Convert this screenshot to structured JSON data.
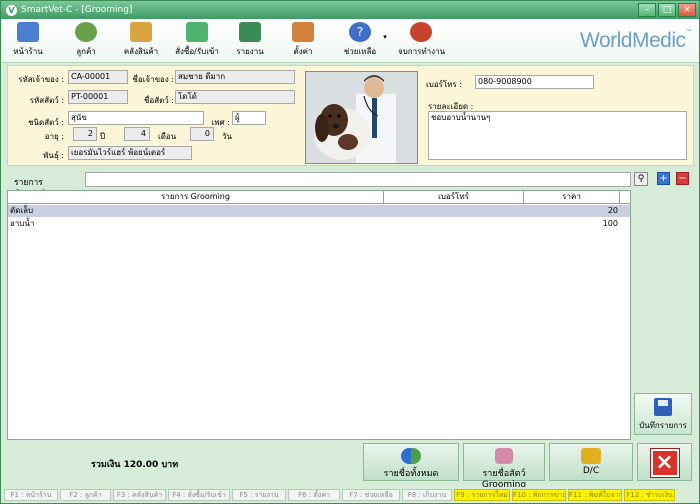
{
  "window": {
    "title": "SmartVet-C  - [Grooming]"
  },
  "toolbar": {
    "items": [
      {
        "label": "หน้าร้าน",
        "icon": "monitor-icon",
        "color": "#4a7fd0"
      },
      {
        "label": "ลูกค้า",
        "icon": "customers-icon",
        "color": "#6aa04a"
      },
      {
        "label": "คลังสินค้า",
        "icon": "warehouse-icon",
        "color": "#d9a441"
      },
      {
        "label": "สั่งซื้อ/รับเข้า",
        "icon": "order-icon",
        "color": "#4fb36f"
      },
      {
        "label": "รายงาน",
        "icon": "report-icon",
        "color": "#3c8a55"
      },
      {
        "label": "ตั้งค่า",
        "icon": "settings-icon",
        "color": "#d0813a"
      },
      {
        "label": "ช่วยเหลือ",
        "icon": "help-icon",
        "color": "#3f6fc8"
      },
      {
        "label": "จบการทำงาน",
        "icon": "exit-icon",
        "color": "#c8432e"
      }
    ],
    "logo": "WorldMedic"
  },
  "owner": {
    "owner_id_label": "รหัสเจ้าของ :",
    "owner_id": "CA-00001",
    "owner_name_label": "ชื่อเจ้าของ :",
    "owner_name": "สมชาย ดีมาก",
    "pet_id_label": "รหัสสัตว์ :",
    "pet_id": "PT-00001",
    "pet_name_label": "ชื่อสัตว์ :",
    "pet_name": "โดโด้",
    "species_label": "ชนิดสัตว์ :",
    "species": "สุนัข",
    "sex_label": "เพศ :",
    "sex": "ผู้",
    "age_label": "อายุ :",
    "age_years": "2",
    "years_unit": "ปี",
    "age_months": "4",
    "months_unit": "เดือน",
    "age_days": "0",
    "days_unit": "วัน",
    "breed_label": "พันธุ์ :",
    "breed": "เยอรมันไวร์แฮร์ พ้อยน์เตอร์"
  },
  "contact": {
    "phone_label": "เบอร์โทร :",
    "phone": "080-9008900",
    "detail_label": "รายละเอียด :",
    "detail": "ชอบอาบน้ำนานๆ"
  },
  "search": {
    "label": "รายการ Grooming",
    "value": ""
  },
  "table": {
    "columns": [
      "รายการ Grooming",
      "เบอร์โทร์",
      "ราคา"
    ],
    "rows": [
      {
        "item": "ตัดเล็บ",
        "phone": "",
        "price": "20"
      },
      {
        "item": "อาบน้ำ",
        "phone": "",
        "price": "100"
      }
    ]
  },
  "side": {
    "save_label": "บันทึกรายการ"
  },
  "footer": {
    "total": "รวมเงิน 120.00 บาท",
    "btn_all": "รายชื่อทั้งหมด",
    "btn_grooming": "รายชื่อสัตว์ Grooming",
    "btn_dc": "D/C"
  },
  "fkeys": [
    {
      "label": "F1 : หน้าร้าน",
      "hl": false
    },
    {
      "label": "F2 : ลูกค้า",
      "hl": false
    },
    {
      "label": "F3 : คลังสินค้า",
      "hl": false
    },
    {
      "label": "F4 : สั่งซื้อ/รับเข้า",
      "hl": false
    },
    {
      "label": "F5 : รายงาน",
      "hl": false
    },
    {
      "label": "F6 : ตั้งค่า",
      "hl": false
    },
    {
      "label": "F7 : ช่วยเหลือ",
      "hl": false
    },
    {
      "label": "F8 : เก็บงาน",
      "hl": false
    },
    {
      "label": "F9 : รายการใหม่",
      "hl": true
    },
    {
      "label": "F10 : พักการขาย",
      "hl": true
    },
    {
      "label": "F11 : พิมพ์ใบจาก",
      "hl": true
    },
    {
      "label": "F12 : ชำระเงิน",
      "hl": true
    }
  ]
}
